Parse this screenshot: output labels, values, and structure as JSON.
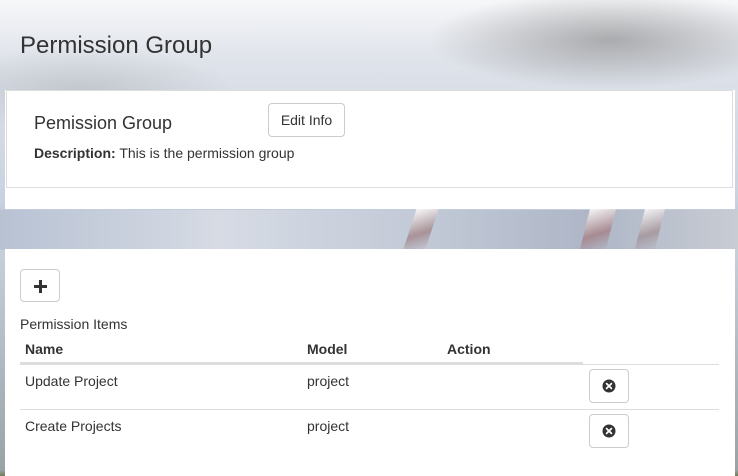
{
  "page": {
    "title": "Permission Group"
  },
  "group": {
    "name": "Pemission Group",
    "edit_label": "Edit Info",
    "description_label": "Description:",
    "description_value": "This is the permission group"
  },
  "items": {
    "add_icon": "plus-icon",
    "caption": "Permission Items",
    "columns": [
      "Name",
      "Model",
      "Action"
    ],
    "rows": [
      {
        "name": "Update Project",
        "model": "project",
        "action_icon": "remove-circle-icon"
      },
      {
        "name": "Create Projects",
        "model": "project",
        "action_icon": "remove-circle-icon"
      }
    ]
  }
}
